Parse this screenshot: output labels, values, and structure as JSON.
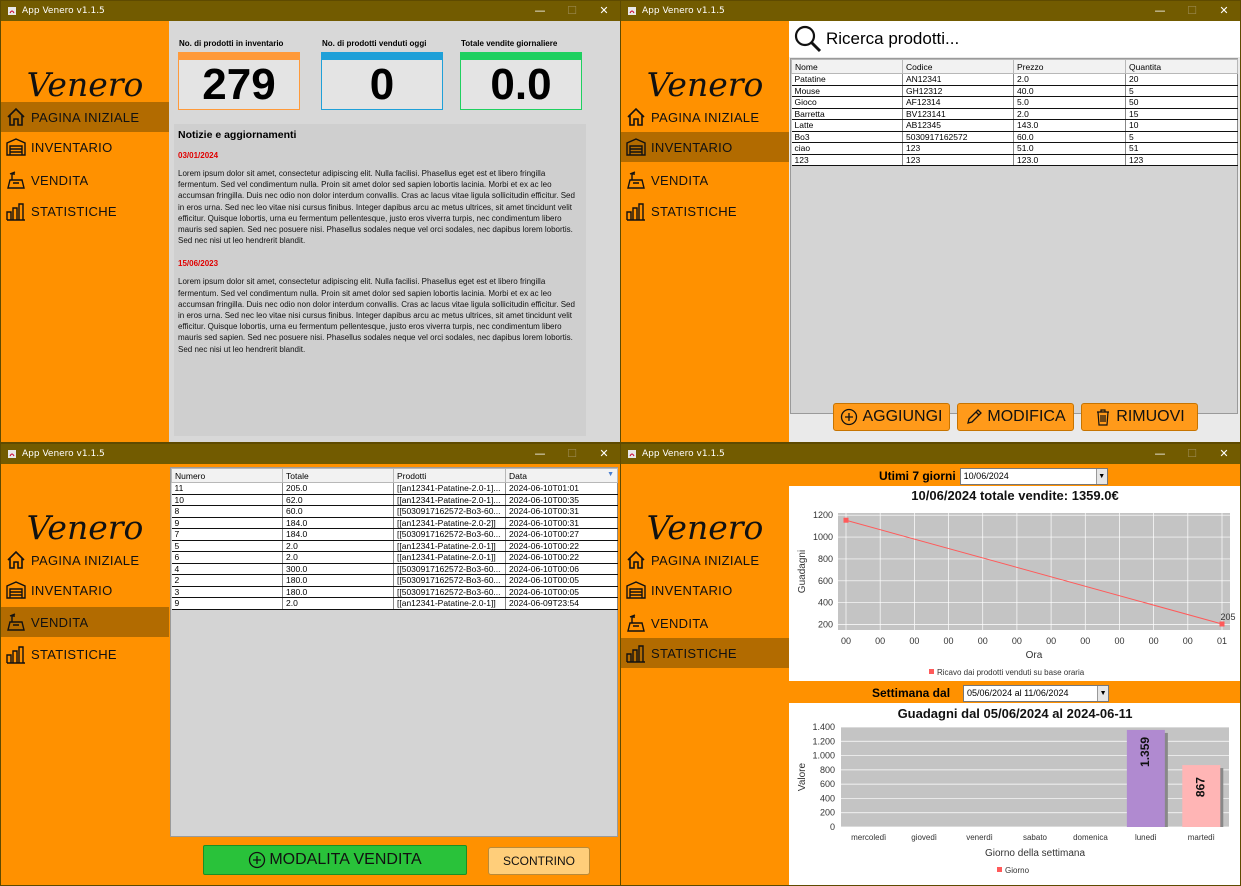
{
  "app": {
    "window_title": "App Venero v1.1.5",
    "logo": "Venero",
    "nav": [
      "PAGINA INIZIALE",
      "INVENTARIO",
      "VENDITA",
      "STATISTICHE"
    ]
  },
  "home": {
    "cards": [
      {
        "title": "No. di prodotti in inventario",
        "value": "279",
        "color": "#ff9a3a"
      },
      {
        "title": "No. di prodotti venduti oggi",
        "value": "0",
        "color": "#1fa0d8"
      },
      {
        "title": "Totale vendite giornaliere",
        "value": "0.0",
        "color": "#1fd060"
      }
    ],
    "news_title": "Notizie e aggiornamenti",
    "news": [
      {
        "date": "03/01/2024",
        "text": "Lorem ipsum dolor sit amet, consectetur adipiscing elit. Nulla facilisi. Phasellus eget est et libero fringilla fermentum. Sed vel condimentum nulla. Proin sit amet dolor sed sapien lobortis lacinia. Morbi et ex ac leo accumsan fringilla. Duis nec odio non dolor interdum convallis. Cras ac lacus vitae ligula sollicitudin efficitur. Sed in eros urna. Sed nec leo vitae nisi cursus finibus. Integer dapibus arcu ac metus ultrices, sit amet tincidunt velit efficitur. Quisque lobortis, urna eu fermentum pellentesque, justo eros viverra turpis, nec condimentum libero mauris sed sapien. Sed nec posuere nisi. Phasellus sodales neque vel orci sodales, nec dapibus lorem lobortis. Sed nec nisi ut leo hendrerit blandit."
      },
      {
        "date": "15/06/2023",
        "text": "Lorem ipsum dolor sit amet, consectetur adipiscing elit. Nulla facilisi. Phasellus eget est et libero fringilla fermentum. Sed vel condimentum nulla. Proin sit amet dolor sed sapien lobortis lacinia. Morbi et ex ac leo accumsan fringilla. Duis nec odio non dolor interdum convallis. Cras ac lacus vitae ligula sollicitudin efficitur. Sed in eros urna. Sed nec leo vitae nisi cursus finibus. Integer dapibus arcu ac metus ultrices, sit amet tincidunt velit efficitur. Quisque lobortis, urna eu fermentum pellentesque, justo eros viverra turpis, nec condimentum libero mauris sed sapien. Sed nec posuere nisi. Phasellus sodales neque vel orci sodales, nec dapibus lorem lobortis. Sed nec nisi ut leo hendrerit blandit."
      }
    ]
  },
  "inventory": {
    "search_placeholder": "Ricerca prodotti...",
    "columns": [
      "Nome",
      "Codice",
      "Prezzo",
      "Quantita"
    ],
    "rows": [
      [
        "Patatine",
        "AN12341",
        "2.0",
        "20"
      ],
      [
        "Mouse",
        "GH12312",
        "40.0",
        "5"
      ],
      [
        "Gioco",
        "AF12314",
        "5.0",
        "50"
      ],
      [
        "Barretta",
        "BV123141",
        "2.0",
        "15"
      ],
      [
        "Latte",
        "AB12345",
        "143.0",
        "10"
      ],
      [
        "Bo3",
        "5030917162572",
        "60.0",
        "5"
      ],
      [
        "ciao",
        "123",
        "51.0",
        "51"
      ],
      [
        "123",
        "123",
        "123.0",
        "123"
      ]
    ],
    "buttons": {
      "add": "AGGIUNGI",
      "edit": "MODIFICA",
      "remove": "RIMUOVI"
    }
  },
  "sales": {
    "columns": [
      "Numero",
      "Totale",
      "Prodotti",
      "Data"
    ],
    "rows": [
      [
        "11",
        "205.0",
        "[[an12341-Patatine-2.0-1]...",
        "2024-06-10T01:01"
      ],
      [
        "10",
        "62.0",
        "[[an12341-Patatine-2.0-1]...",
        "2024-06-10T00:35"
      ],
      [
        "8",
        "60.0",
        "[[5030917162572-Bo3-60...",
        "2024-06-10T00:31"
      ],
      [
        "9",
        "184.0",
        "[[an12341-Patatine-2.0-2]]",
        "2024-06-10T00:31"
      ],
      [
        "7",
        "184.0",
        "[[5030917162572-Bo3-60...",
        "2024-06-10T00:27"
      ],
      [
        "5",
        "2.0",
        "[[an12341-Patatine-2.0-1]]",
        "2024-06-10T00:22"
      ],
      [
        "6",
        "2.0",
        "[[an12341-Patatine-2.0-1]]",
        "2024-06-10T00:22"
      ],
      [
        "4",
        "300.0",
        "[[5030917162572-Bo3-60...",
        "2024-06-10T00:06"
      ],
      [
        "2",
        "180.0",
        "[[5030917162572-Bo3-60...",
        "2024-06-10T00:05"
      ],
      [
        "3",
        "180.0",
        "[[5030917162572-Bo3-60...",
        "2024-06-10T00:05"
      ],
      [
        "9",
        "2.0",
        "[[an12341-Patatine-2.0-1]]",
        "2024-06-09T23:54"
      ]
    ],
    "buttons": {
      "mode": "MODALITA VENDITA",
      "receipt": "SCONTRINO"
    }
  },
  "stats": {
    "last7_label": "Utimi 7 giorni",
    "last7_value": "10/06/2024",
    "week_label": "Settimana dal",
    "week_value": "05/06/2024 al 11/06/2024"
  },
  "chart_data": [
    {
      "type": "line",
      "title": "10/06/2024 totale vendite: 1359.0€",
      "xlabel": "Ora",
      "ylabel": "Guadagni",
      "x": [
        "00",
        "00",
        "00",
        "00",
        "00",
        "00",
        "00",
        "00",
        "00",
        "00",
        "00",
        "01"
      ],
      "series": [
        {
          "name": "Ricavo dai prodotti venduti su base oraria",
          "points": [
            {
              "x": 0,
              "y": 1154
            },
            {
              "x": 11,
              "y": 205
            }
          ],
          "labels": [
            "",
            "205"
          ]
        }
      ],
      "yticks": [
        200,
        400,
        600,
        800,
        1000,
        1200
      ],
      "ylim": [
        150,
        1220
      ],
      "grid": true,
      "color": "#ff5a5a"
    },
    {
      "type": "bar",
      "title": "Guadagni dal 05/06/2024 al 2024-06-11",
      "xlabel": "Giorno della settimana",
      "ylabel": "Valore",
      "categories": [
        "mercoledì",
        "giovedì",
        "venerdì",
        "sabato",
        "domenica",
        "lunedì",
        "martedì"
      ],
      "values": [
        0,
        0,
        0,
        0,
        0,
        1359,
        867
      ],
      "value_labels": [
        "",
        "",
        "",
        "",
        "",
        "1.359",
        "867"
      ],
      "bar_colors": [
        "#b08ad0",
        "#b08ad0",
        "#b08ad0",
        "#b08ad0",
        "#b08ad0",
        "#b08ad0",
        "#ffb5b5"
      ],
      "yticks": [
        "0",
        "200",
        "400",
        "600",
        "800",
        "1.000",
        "1.200",
        "1.400"
      ],
      "ylim": [
        0,
        1400
      ],
      "legend": "Giorno",
      "grid": true
    }
  ]
}
